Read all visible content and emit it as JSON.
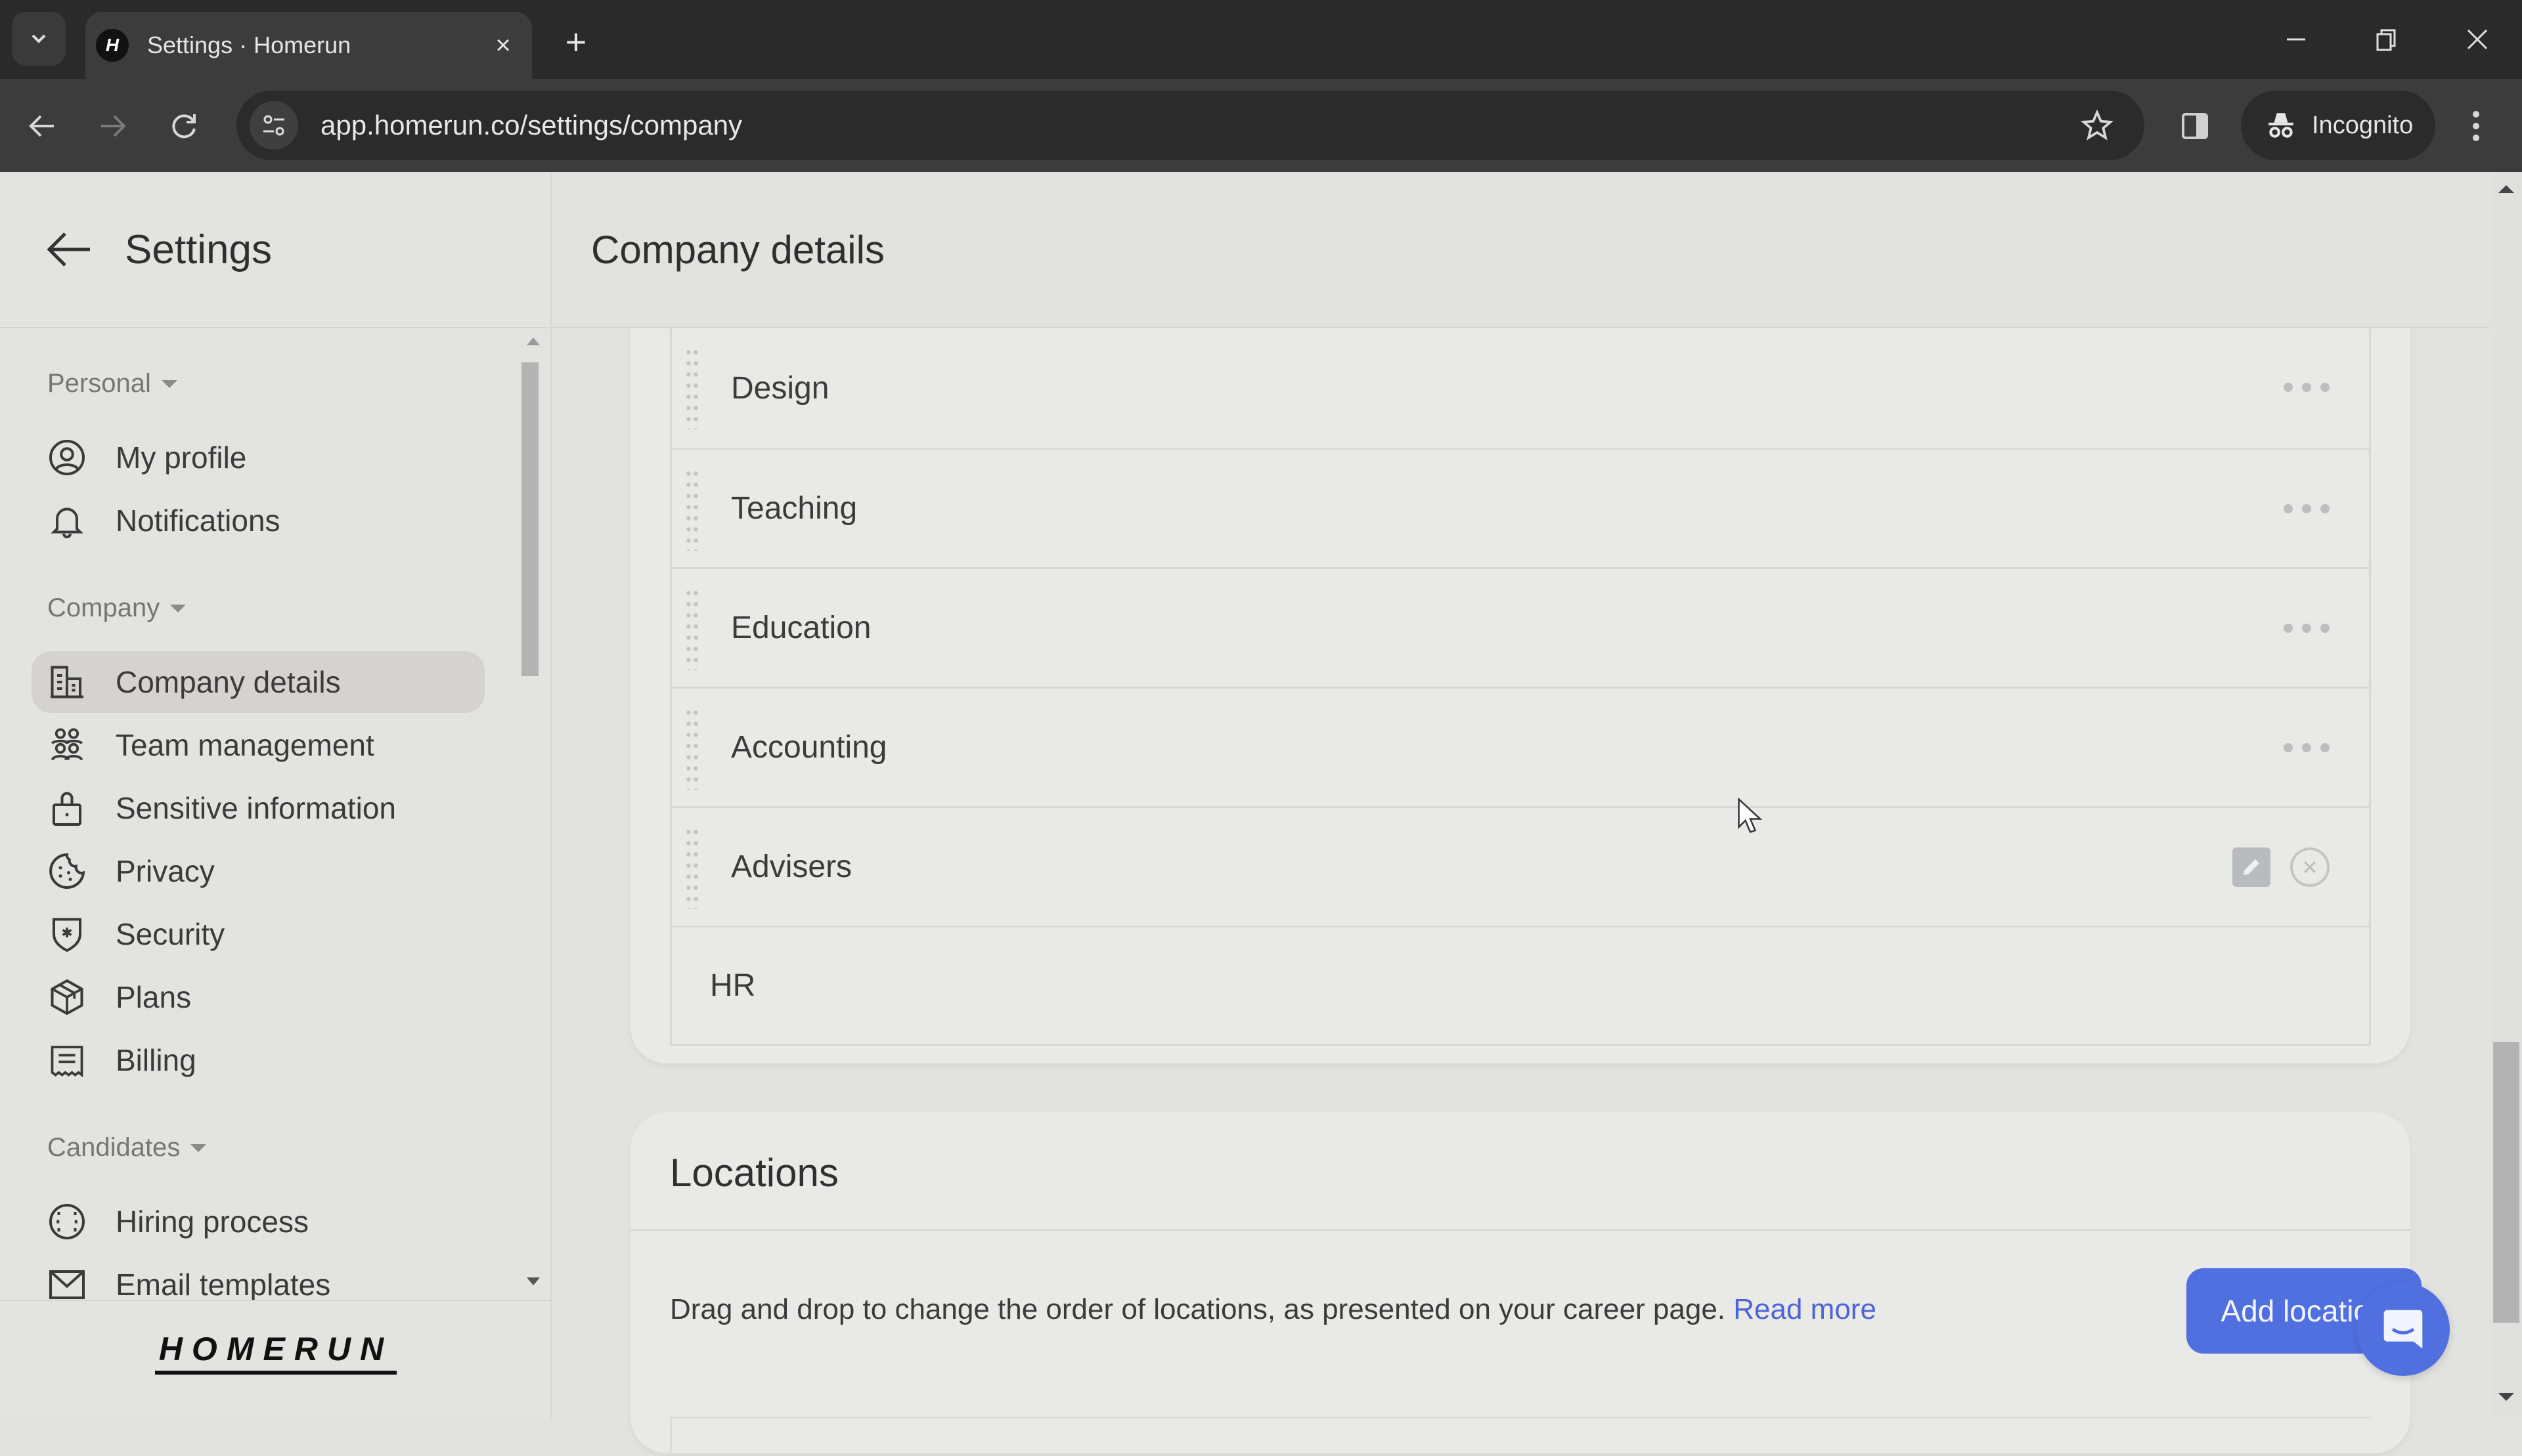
{
  "browser": {
    "tab_title": "Settings · Homerun",
    "favicon_letter": "H",
    "url": "app.homerun.co/settings/company",
    "incognito_label": "Incognito",
    "new_tab_glyph": "+",
    "close_tab_glyph": "×"
  },
  "sidebar": {
    "title": "Settings",
    "groups": [
      {
        "label": "Personal",
        "items": [
          {
            "label": "My profile",
            "icon": "user-circle-icon"
          },
          {
            "label": "Notifications",
            "icon": "bell-icon"
          }
        ]
      },
      {
        "label": "Company",
        "items": [
          {
            "label": "Company details",
            "icon": "building-icon",
            "active": true
          },
          {
            "label": "Team management",
            "icon": "team-icon"
          },
          {
            "label": "Sensitive information",
            "icon": "lock-icon"
          },
          {
            "label": "Privacy",
            "icon": "cookie-icon"
          },
          {
            "label": "Security",
            "icon": "shield-icon"
          },
          {
            "label": "Plans",
            "icon": "box-icon"
          },
          {
            "label": "Billing",
            "icon": "receipt-icon"
          }
        ]
      },
      {
        "label": "Candidates",
        "items": [
          {
            "label": "Hiring process",
            "icon": "baseball-icon"
          },
          {
            "label": "Email templates",
            "icon": "envelope-icon"
          }
        ]
      }
    ],
    "logo_text": "HOMERUN"
  },
  "main": {
    "title": "Company details",
    "departments": {
      "items": [
        {
          "name": "Design",
          "actions": "menu"
        },
        {
          "name": "Teaching",
          "actions": "menu"
        },
        {
          "name": "Education",
          "actions": "menu"
        },
        {
          "name": "Accounting",
          "actions": "menu"
        },
        {
          "name": "Advisers",
          "actions": "edit-remove"
        }
      ],
      "new_entry_value": "HR"
    },
    "locations": {
      "title": "Locations",
      "description": "Drag and drop to change the order of locations, as presented on your career page.",
      "read_more_label": "Read more",
      "add_button_label": "Add location"
    }
  },
  "colors": {
    "accent": "#5170e0",
    "link": "#4c65d6",
    "background": "#e2e2df",
    "card": "#e9e9e8"
  }
}
